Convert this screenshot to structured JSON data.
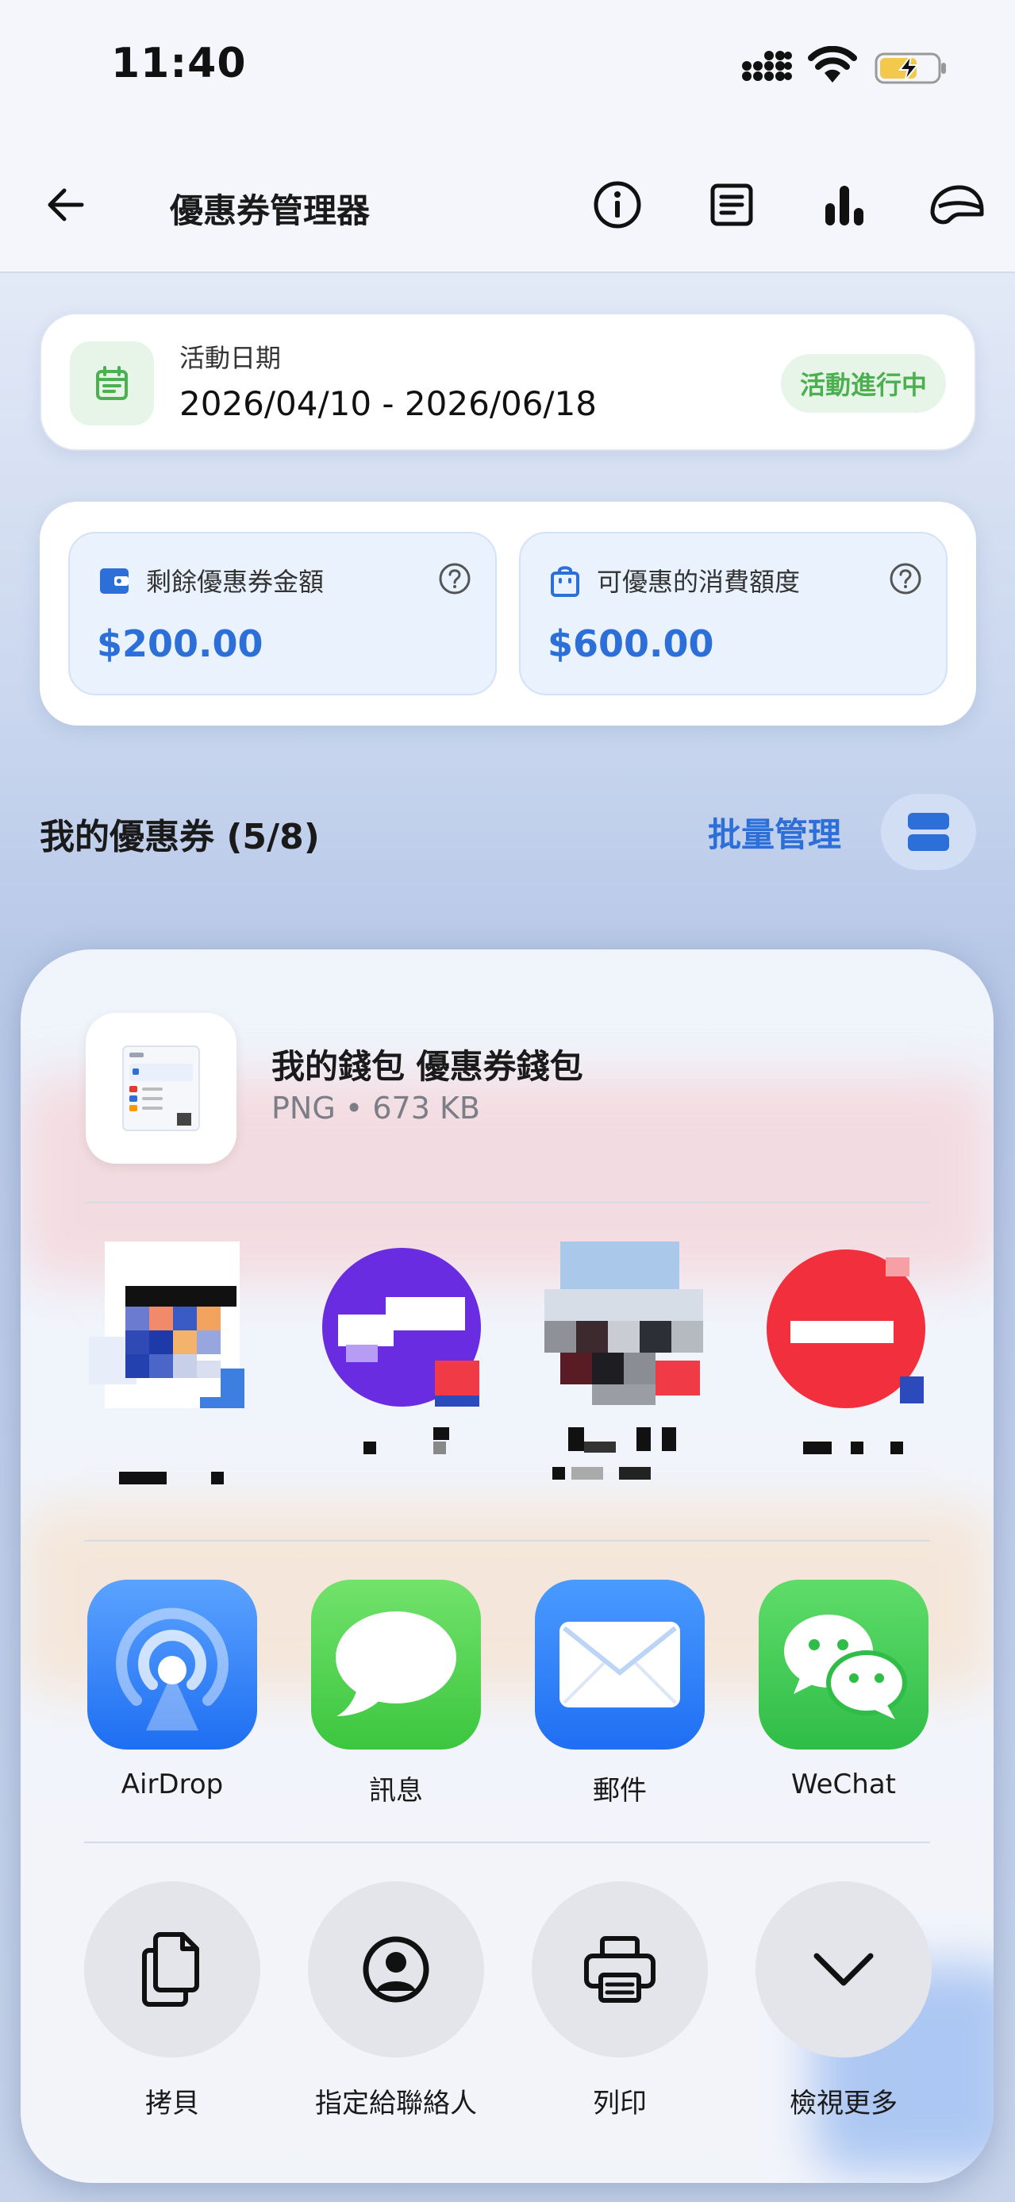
{
  "status_bar": {
    "time": "11:40"
  },
  "app_bar": {
    "back_icon": "arrow-left-icon",
    "title": "優惠券管理器",
    "actions": [
      "info-icon",
      "document-icon",
      "bar-chart-icon",
      "cap-icon"
    ]
  },
  "event": {
    "label": "活動日期",
    "date_range": "2026/04/10 - 2026/06/18",
    "status": "活動進行中",
    "status_color": "#4caf50"
  },
  "summary": {
    "remaining": {
      "label": "剩餘優惠券金額",
      "value": "$200.00",
      "icon": "wallet-icon"
    },
    "eligible": {
      "label": "可優惠的消費額度",
      "value": "$600.00",
      "icon": "shopping-bag-icon"
    },
    "accent_color": "#2c6fd8"
  },
  "coupons_section": {
    "title": "我的優惠券 (5/8)",
    "batch_label": "批量管理"
  },
  "share_sheet": {
    "file_title": "我的錢包 優惠券錢包",
    "file_meta": "PNG • 673 KB",
    "apps": [
      {
        "label": "AirDrop",
        "icon": "airdrop-icon"
      },
      {
        "label": "訊息",
        "icon": "messages-icon"
      },
      {
        "label": "郵件",
        "icon": "mail-icon"
      },
      {
        "label": "WeChat",
        "icon": "wechat-icon"
      }
    ],
    "actions": [
      {
        "label": "拷貝",
        "icon": "copy-icon"
      },
      {
        "label": "指定給聯絡人",
        "icon": "contact-icon"
      },
      {
        "label": "列印",
        "icon": "printer-icon"
      },
      {
        "label": "檢視更多",
        "icon": "chevron-down-icon"
      }
    ]
  }
}
